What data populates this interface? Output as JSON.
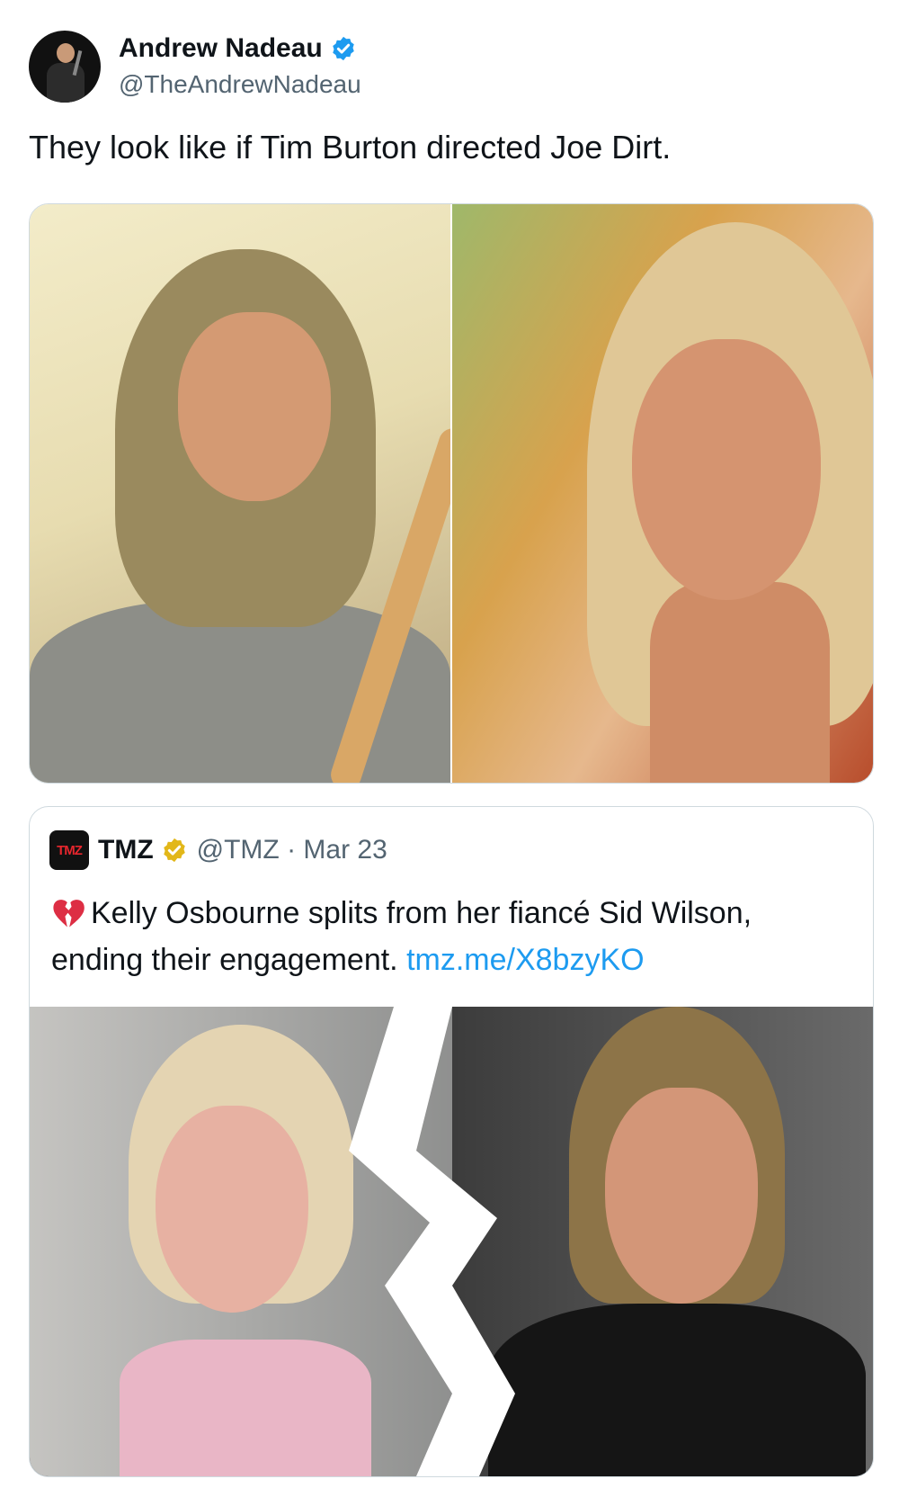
{
  "tweet": {
    "display_name": "Andrew Nadeau",
    "handle": "@TheAndrewNadeau",
    "text": "They look like if Tim Burton directed Joe Dirt.",
    "verified_color": "#1d9bf0"
  },
  "media": {
    "photos": [
      "left-photo",
      "right-photo"
    ]
  },
  "quote": {
    "logo_text": "TMZ",
    "display_name": "TMZ",
    "handle_date": "@TMZ · Mar 23",
    "badge_color": "#e2b719",
    "emoji": "broken-heart-icon",
    "text": "Kelly Osbourne splits from her fiancé Sid Wilson, ending their engagement.",
    "link": "tmz.me/X8bzyKO",
    "link_color": "#1d9bf0"
  }
}
